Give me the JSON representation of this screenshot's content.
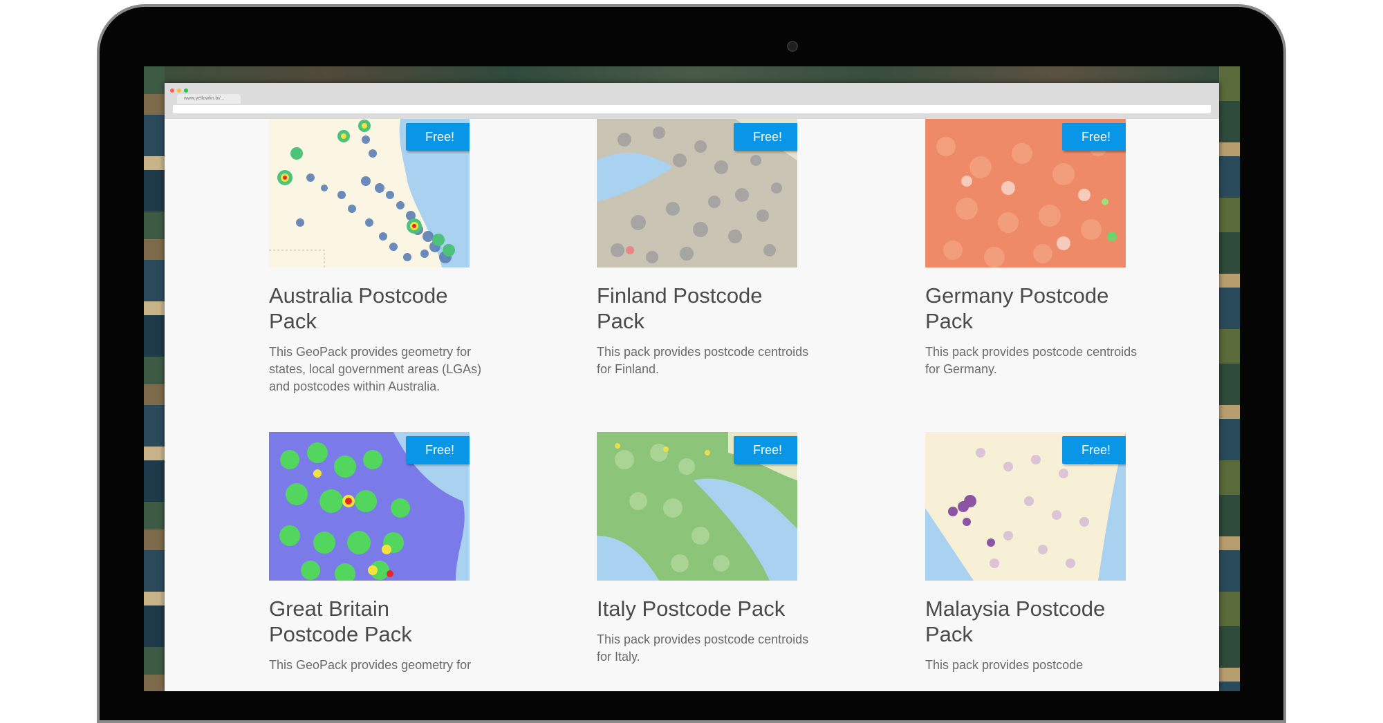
{
  "browser": {
    "url": "www.yellowfin.bi/..."
  },
  "colors": {
    "badge": "#0a96e6",
    "title": "#4a4a4a",
    "desc": "#6a6a6a"
  },
  "packs": [
    {
      "title": "Australia Postcode Pack",
      "badge": "Free!",
      "description": "This GeoPack provides geometry for states, local government areas (LGAs) and postcodes within Australia."
    },
    {
      "title": "Finland Postcode Pack",
      "badge": "Free!",
      "description": "This pack provides postcode centroids for Finland."
    },
    {
      "title": "Germany Postcode Pack",
      "badge": "Free!",
      "description": "This pack provides postcode centroids for Germany."
    },
    {
      "title": "Great Britain Postcode Pack",
      "badge": "Free!",
      "description": "This GeoPack provides geometry for"
    },
    {
      "title": "Italy Postcode Pack",
      "badge": "Free!",
      "description": "This pack provides postcode centroids for Italy."
    },
    {
      "title": "Malaysia Postcode Pack",
      "badge": "Free!",
      "description": "This pack provides postcode"
    }
  ]
}
